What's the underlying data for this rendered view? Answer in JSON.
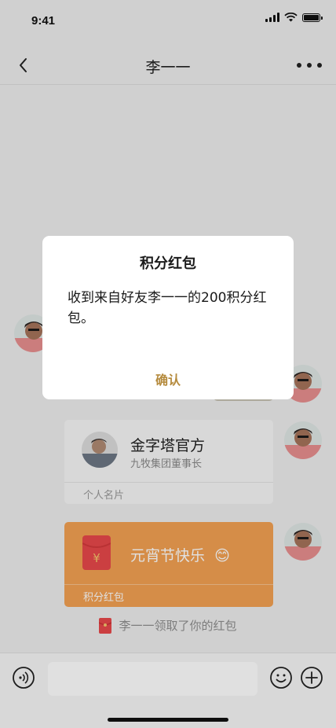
{
  "status_bar": {
    "time": "9:41"
  },
  "nav": {
    "title": "李一一"
  },
  "card": {
    "name": "金字塔官方",
    "subtitle": "九牧集团董事长",
    "footer": "个人名片"
  },
  "red_packet": {
    "greeting": "元宵节快乐",
    "emoji": "😊",
    "footer": "积分红包",
    "symbol": "¥"
  },
  "system_message": {
    "text": "李一一领取了你的红包"
  },
  "dialog": {
    "title": "积分红包",
    "body": "收到来自好友李一一的200积分红包。",
    "confirm": "确认"
  },
  "colors": {
    "accent_gold": "#b58b3e",
    "red_packet_orange": "#f3a152",
    "red_packet_icon": "#e8484a"
  }
}
